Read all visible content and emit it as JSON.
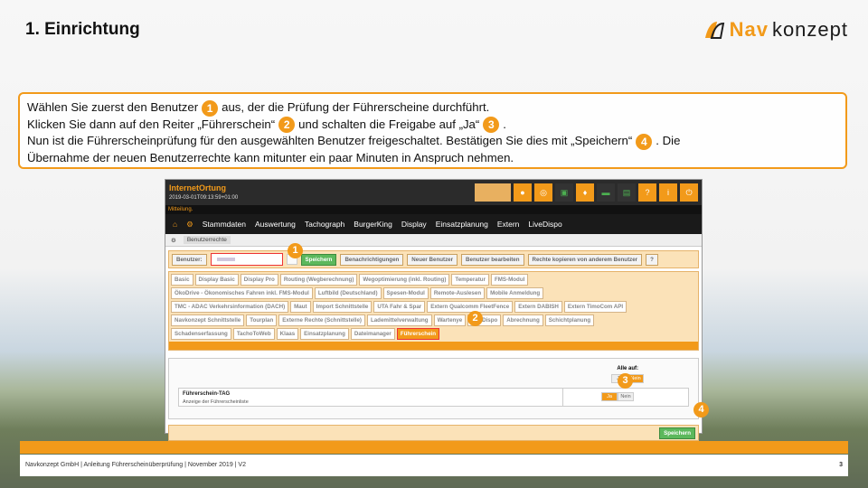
{
  "slide": {
    "title": "1. Einrichtung",
    "logo_nav": "Nav",
    "logo_konz": "konzept"
  },
  "instructions": {
    "line1_a": "Wählen Sie zuerst den Benutzer",
    "line1_b": "aus, der die Prüfung der Führerscheine durchführt.",
    "line2_a": "Klicken Sie dann auf den Reiter „Führerschein“",
    "line2_b": "und schalten die Freigabe auf „Ja“",
    "line3_a": "Nun ist die Führerscheinprüfung für den ausgewählten Benutzer freigeschaltet. Bestätigen Sie dies mit „Speichern“",
    "line3_b": ". Die",
    "line4": "Übernahme der neuen Benutzerrechte kann mitunter ein paar Minuten in Anspruch nehmen.",
    "badges": [
      "1",
      "2",
      "3",
      "4"
    ]
  },
  "app": {
    "brand": "InternetOrtung",
    "timestamp": "2019-03-01T09:13:59+01:00",
    "message": "Mitteilung.",
    "menu": [
      "Stammdaten",
      "Auswertung",
      "Tachograph",
      "BurgerKing",
      "Display",
      "Einsatzplanung",
      "Extern",
      "LiveDispo"
    ],
    "breadcrumb": "Benutzerrechte",
    "user_label": "Benutzer:",
    "buttons": [
      "Speichern",
      "Benachrichtigungen",
      "Neuer Benutzer",
      "Benutzer bearbeiten",
      "Rechte kopieren von anderem Benutzer",
      "?"
    ],
    "tabs": [
      [
        "Basic",
        "Display Basic",
        "Display Pro",
        "Routing (Wegberechnung)",
        "Wegoptimierung (inkl. Routing)",
        "Temperatur",
        "FMS-Modul"
      ],
      [
        "ÖkoDrive - Ökonomisches Fahren inkl. FMS-Modul",
        "Luftbild (Deutschland)",
        "Spesen-Modul",
        "Remote-Auslesen",
        "Mobile Anmeldung"
      ],
      [
        "TMC - ADAC Verkehrsinformation (DACH)",
        "Maut",
        "Import Schnittstelle",
        "UTA Fahr & Spar",
        "Extern Qualcomm FleetFence",
        "Extern DABISH",
        "Extern TimoCom API"
      ],
      [
        "Navkonzept Schnittstelle",
        "Tourplan",
        "Externe Rechte (Schnittstelle)",
        "Lademittelverwaltung",
        "Wartenye",
        "TaxiDispo",
        "Abrechnung",
        "Schichtplanung"
      ],
      [
        "Schadenserfassung",
        "TachoToWeb",
        "Klaas",
        "Einsatzplanung",
        "Dateimanager",
        "Führerschein"
      ]
    ],
    "all_label": "Alle auf:",
    "ja": "Ja",
    "nein": "Nein",
    "feature_name": "Führerschein-TAG",
    "feature_desc": "Anzeige der Führerscheinliste",
    "save": "Speichern"
  },
  "footer": {
    "text": "Navkonzept GmbH  |  Anleitung Führerscheinüberprüfung  |  November 2019  |  V2",
    "page": "3"
  },
  "colors": {
    "accent": "#f29a1a",
    "dark": "#1a1a1a",
    "highlight": "#e33333"
  }
}
